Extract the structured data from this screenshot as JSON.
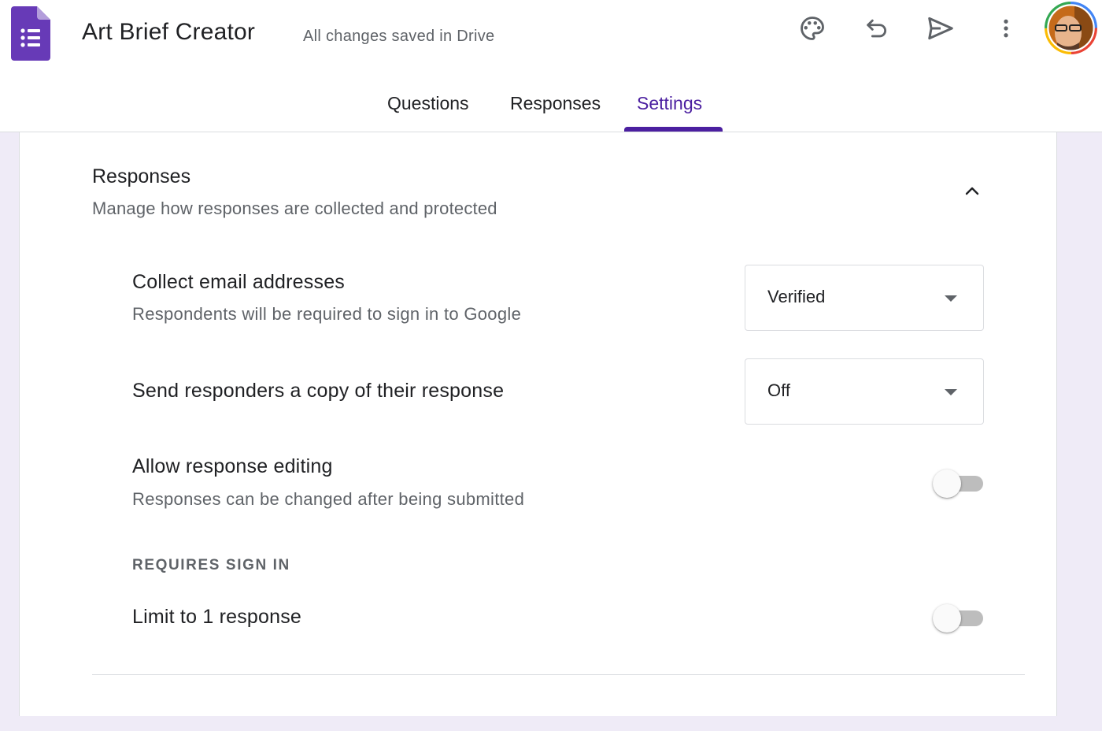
{
  "header": {
    "app_title": "Art Brief Creator",
    "save_status": "All changes saved in Drive",
    "icons": [
      "palette-icon",
      "undo-icon",
      "send-icon",
      "more-vert-icon"
    ],
    "brand_color": "#673ab7"
  },
  "tabs": [
    {
      "label": "Questions",
      "active": false
    },
    {
      "label": "Responses",
      "active": false
    },
    {
      "label": "Settings",
      "active": true
    }
  ],
  "section": {
    "title": "Responses",
    "subtitle": "Manage how responses are collected and protected",
    "expanded": true
  },
  "settings": {
    "collect_email": {
      "title": "Collect email addresses",
      "subtitle": "Respondents will be required to sign in to Google",
      "value": "Verified"
    },
    "send_copy": {
      "title": "Send responders a copy of their response",
      "value": "Off"
    },
    "allow_editing": {
      "title": "Allow response editing",
      "subtitle": "Responses can be changed after being submitted",
      "enabled": false
    },
    "requires_sign_in_label": "REQUIRES SIGN IN",
    "limit_one": {
      "title": "Limit to 1 response",
      "enabled": false
    }
  },
  "colors": {
    "accent": "#4b1fa0",
    "page_bg": "#efebf7"
  }
}
